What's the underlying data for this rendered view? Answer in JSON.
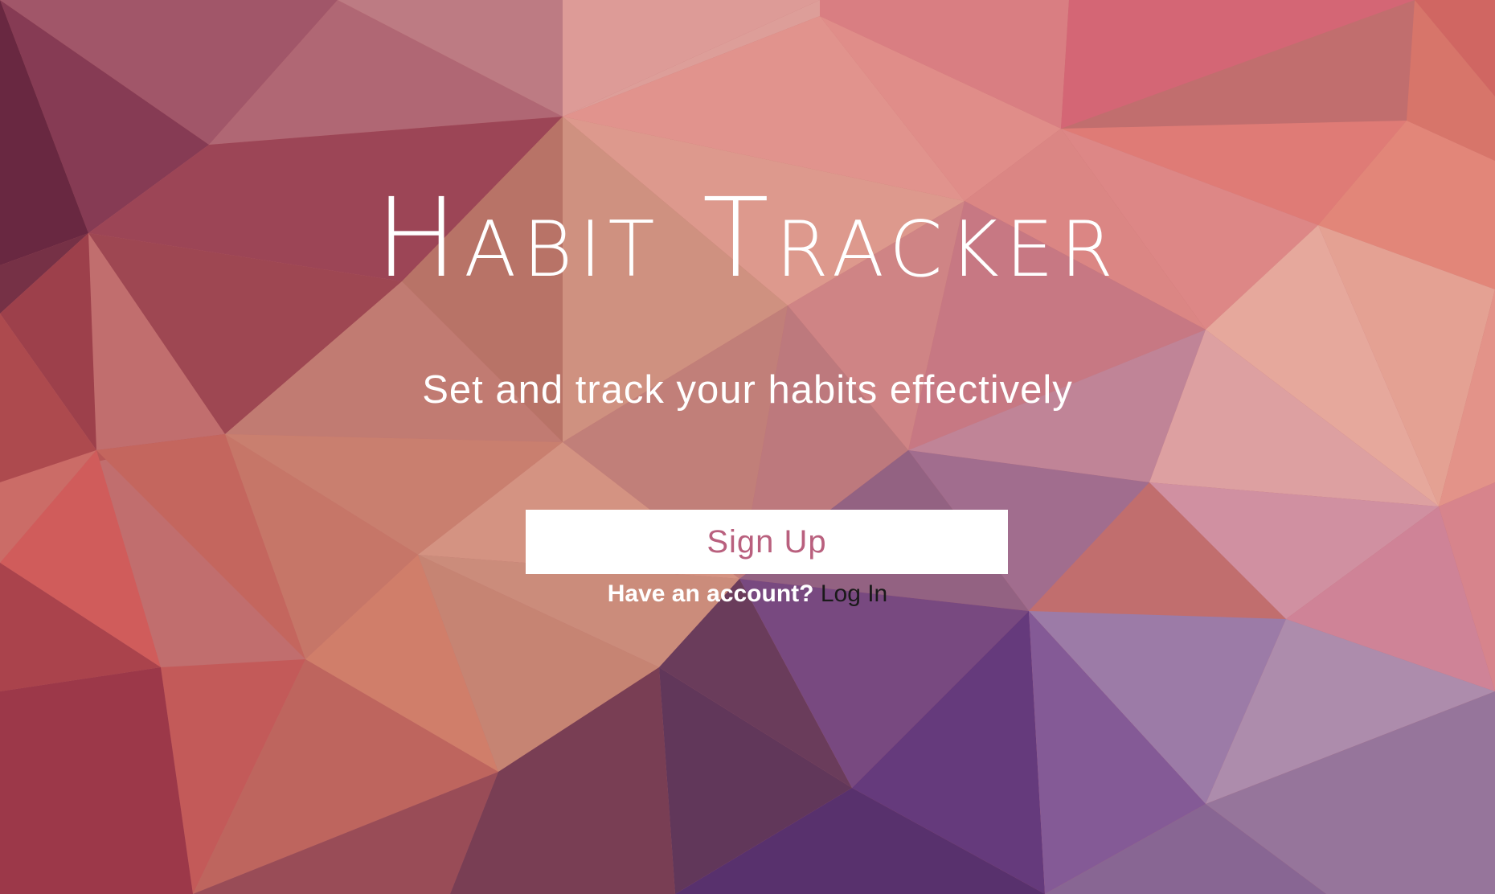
{
  "hero": {
    "title": "Habit Tracker",
    "tagline": "Set and track your habits effectively"
  },
  "actions": {
    "signup_label": "Sign Up",
    "account_prompt": "Have an account?",
    "login_label": "Log In"
  },
  "colors": {
    "button_background": "#ffffff",
    "button_text": "#b9607e",
    "login_link": "#1a1a1a",
    "hero_text": "#ffffff"
  }
}
